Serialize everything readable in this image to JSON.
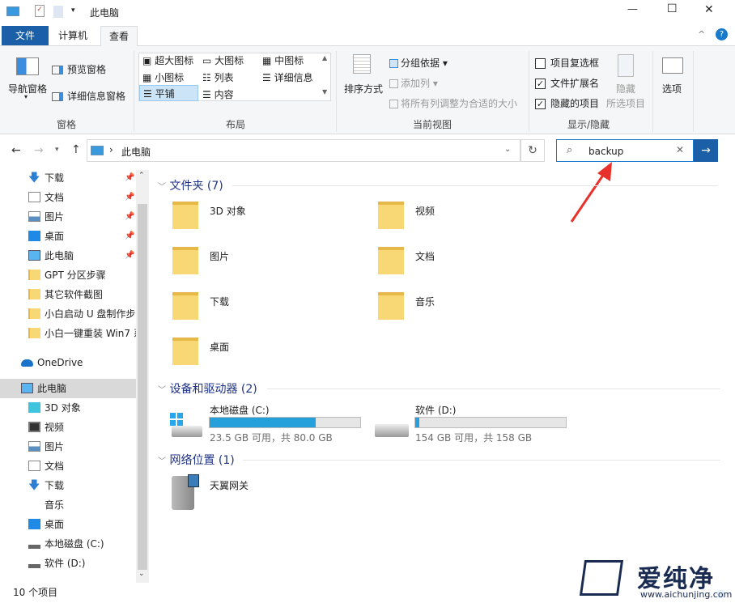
{
  "window": {
    "title": "此电脑",
    "minimize": "—",
    "maximize": "☐",
    "close": "✕",
    "help": "?",
    "collapse": "^"
  },
  "tabs": [
    {
      "label": "文件"
    },
    {
      "label": "计算机"
    },
    {
      "label": "查看"
    }
  ],
  "ribbon": {
    "panes": {
      "nav_pane": "导航窗格",
      "preview_pane": "预览窗格",
      "details_pane": "详细信息窗格",
      "group": "窗格"
    },
    "layout": {
      "items": [
        "超大图标",
        "大图标",
        "中图标",
        "小图标",
        "列表",
        "详细信息",
        "平铺",
        "内容"
      ],
      "selected": "平铺",
      "group": "布局"
    },
    "current_view": {
      "sort": "排序方式",
      "group_by": "分组依据",
      "add_column": "添加列",
      "fit_columns": "将所有列调整为合适的大小",
      "group": "当前视图"
    },
    "show_hide": {
      "item_checkboxes": {
        "label": "项目复选框",
        "checked": false
      },
      "file_extensions": {
        "label": "文件扩展名",
        "checked": true
      },
      "hidden_items": {
        "label": "隐藏的项目",
        "checked": true
      },
      "hide_selected_1": "隐藏",
      "hide_selected_2": "所选项目",
      "group": "显示/隐藏"
    },
    "options": "选项"
  },
  "address": {
    "path": "此电脑",
    "separator": "›"
  },
  "search": {
    "value": "backup"
  },
  "nav": {
    "quick": [
      {
        "label": "下载",
        "icon": "download-icon"
      },
      {
        "label": "文档",
        "icon": "document-icon"
      },
      {
        "label": "图片",
        "icon": "picture-icon"
      },
      {
        "label": "桌面",
        "icon": "desktop-icon"
      },
      {
        "label": "此电脑",
        "icon": "computer-icon"
      }
    ],
    "folders": [
      "GPT 分区步骤",
      "其它软件截图",
      "小白启动 U 盘制作步",
      "小白一键重装 Win7 系"
    ],
    "onedrive": "OneDrive",
    "this_pc": "此电脑",
    "pc_items": [
      {
        "label": "3D 对象"
      },
      {
        "label": "视频"
      },
      {
        "label": "图片"
      },
      {
        "label": "文档"
      },
      {
        "label": "下载"
      },
      {
        "label": "音乐"
      },
      {
        "label": "桌面"
      },
      {
        "label": "本地磁盘 (C:)"
      },
      {
        "label": "软件 (D:)"
      }
    ]
  },
  "content": {
    "folders_header": "文件夹 (7)",
    "folders": [
      "3D 对象",
      "视频",
      "图片",
      "文档",
      "下载",
      "音乐",
      "桌面"
    ],
    "devices_header": "设备和驱动器 (2)",
    "drives": [
      {
        "name": "本地磁盘 (C:)",
        "info": "23.5 GB 可用，共 80.0 GB",
        "used_percent": 70.6
      },
      {
        "name": "软件 (D:)",
        "info": "154 GB 可用，共 158 GB",
        "used_percent": 2.5
      }
    ],
    "network_header": "网络位置 (1)",
    "network": [
      "天翼网关"
    ]
  },
  "status": {
    "count": "10 个项目"
  },
  "watermark": {
    "text": "爱纯净",
    "url": "www.aichunjing.com"
  },
  "colors": {
    "accent": "#1979ca",
    "file_tab": "#1a5fa8",
    "bar": "#26a0da",
    "annotation": "#e8312a"
  }
}
